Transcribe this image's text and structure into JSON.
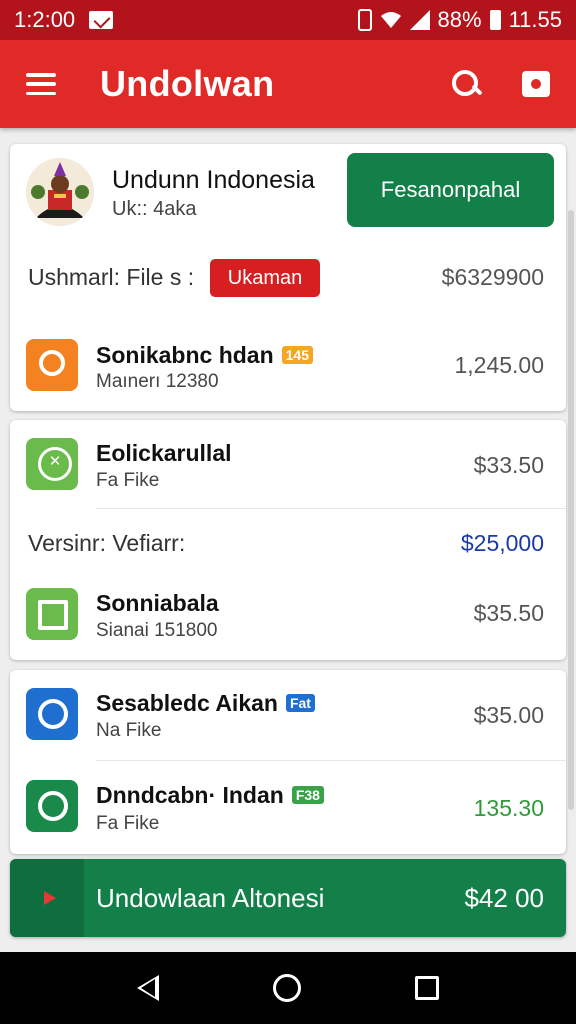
{
  "status_bar": {
    "time_left": "1:2:00",
    "battery_percent": "88%",
    "time_right": "11.55"
  },
  "app_bar": {
    "title": "Undolwan"
  },
  "header_card": {
    "name": "Undunn Indonesia",
    "subtitle": "Uk:: 4aka",
    "primary_button": "Fesanonpahal",
    "label": "Ushmarl: File s :",
    "badge": "Ukaman",
    "amount": "$6329900"
  },
  "items": [
    {
      "title": "Sonikabnc hdan",
      "badge": "145",
      "subtitle": "Maınerı 12380",
      "amount": "1,245.00"
    },
    {
      "title": "Eolickarullal",
      "subtitle": "Fa Fike",
      "amount": "$33.50"
    },
    {
      "title": "Sonniabala",
      "subtitle": "Sianai 151800",
      "amount": "$35.50"
    },
    {
      "title": "Sesabledc Aikan",
      "badge": "Fat",
      "subtitle": "Na Fike",
      "amount": "$35.00"
    },
    {
      "title": "Dnndcabn· Indan",
      "badge": "F38",
      "subtitle": "Fa Fike",
      "amount": "135.30"
    }
  ],
  "version_row": {
    "label": "Versinr: Vefiarr:",
    "amount": "$25,000"
  },
  "bottom_bar": {
    "label": "Undowlaan Altonesi",
    "amount": "$42 00"
  },
  "colors": {
    "status_bar": "#b3141c",
    "app_bar": "#e02a27",
    "primary_green": "#138049",
    "badge_red": "#d71f22",
    "version_amount": "#1b3aa8",
    "positive_amount": "#2e9a3a"
  },
  "icons": {
    "status": [
      "mail-icon",
      "vibrate-icon",
      "wifi-icon",
      "signal-icon",
      "battery-icon"
    ],
    "app_bar": [
      "menu-icon",
      "search-icon",
      "ticket-icon"
    ],
    "nav": [
      "back-icon",
      "home-icon",
      "recents-icon"
    ]
  }
}
